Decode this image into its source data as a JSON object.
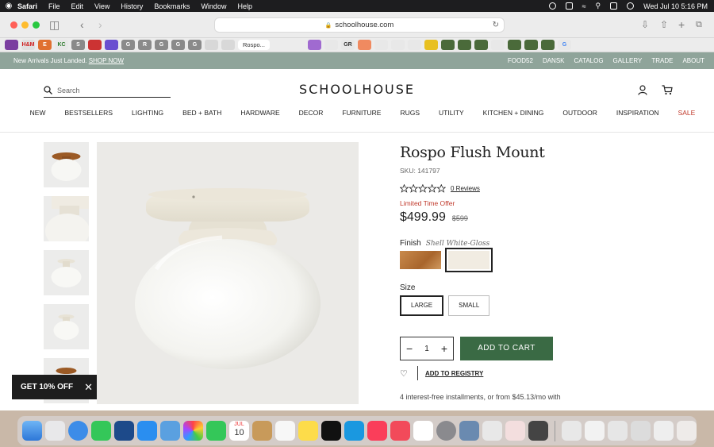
{
  "menubar": {
    "apple": "",
    "app": "Safari",
    "items": [
      "File",
      "Edit",
      "View",
      "History",
      "Bookmarks",
      "Window",
      "Help"
    ],
    "clock": "Wed Jul 10  5:16 PM"
  },
  "browser": {
    "url": "schoolhouse.com",
    "active_tab_label": "Rospo...",
    "favorites": [
      {
        "label": "H&M",
        "color": "#e0e0e0",
        "text": "#d01f1f"
      },
      {
        "label": "E",
        "color": "#e07030",
        "text": "#fff"
      },
      {
        "label": "KC",
        "color": "#e8e8e8",
        "text": "#2a7a2a"
      },
      {
        "label": "S",
        "color": "#8a8a8a",
        "text": "#fff"
      },
      {
        "label": "G",
        "color": "#8a8a8a",
        "text": "#fff"
      },
      {
        "label": "R",
        "color": "#8a8a8a",
        "text": "#fff"
      },
      {
        "label": "G",
        "color": "#8a8a8a",
        "text": "#fff"
      },
      {
        "label": "G",
        "color": "#8a8a8a",
        "text": "#fff"
      },
      {
        "label": "G",
        "color": "#8a8a8a",
        "text": "#fff"
      },
      {
        "label": "GR",
        "color": "#e8e8e8",
        "text": "#333"
      },
      {
        "label": "G",
        "color": "#e8e8e8",
        "text": "#4285f4"
      }
    ]
  },
  "promo": {
    "text": "New Arrivals Just Landed.",
    "link": "SHOP NOW",
    "links": [
      "FOOD52",
      "DANSK",
      "CATALOG",
      "GALLERY",
      "TRADE",
      "ABOUT"
    ]
  },
  "header": {
    "search_placeholder": "Search",
    "logo": "SCHOOLHOUSE"
  },
  "nav": [
    "NEW",
    "BESTSELLERS",
    "LIGHTING",
    "BED + BATH",
    "HARDWARE",
    "DECOR",
    "FURNITURE",
    "RUGS",
    "UTILITY",
    "KITCHEN + DINING",
    "OUTDOOR",
    "INSPIRATION"
  ],
  "nav_sale": "SALE",
  "product": {
    "title": "Rospo Flush Mount",
    "sku": "SKU: 141797",
    "reviews": "0 Reviews",
    "rating": 0,
    "offer": "Limited Time Offer",
    "price": "$499.99",
    "was_price": "$599",
    "finish_label": "Finish",
    "finish_value": "Shell White-Gloss",
    "finish_colors": [
      "#b5773f",
      "#f1ece2"
    ],
    "size_label": "Size",
    "sizes": [
      "LARGE",
      "SMALL"
    ],
    "qty": "1",
    "add_to_cart": "ADD TO CART",
    "add_to_registry": "ADD TO REGISTRY",
    "installments": "4 interest-free installments, or from $45.13/mo with"
  },
  "popup": {
    "label": "GET 10% OFF"
  },
  "colors": {
    "promo_bg": "#8fa49a",
    "cart_green": "#3a6a44",
    "sale_red": "#c0392b"
  },
  "dock": {
    "calendar_month": "JUL",
    "calendar_day": "10"
  }
}
